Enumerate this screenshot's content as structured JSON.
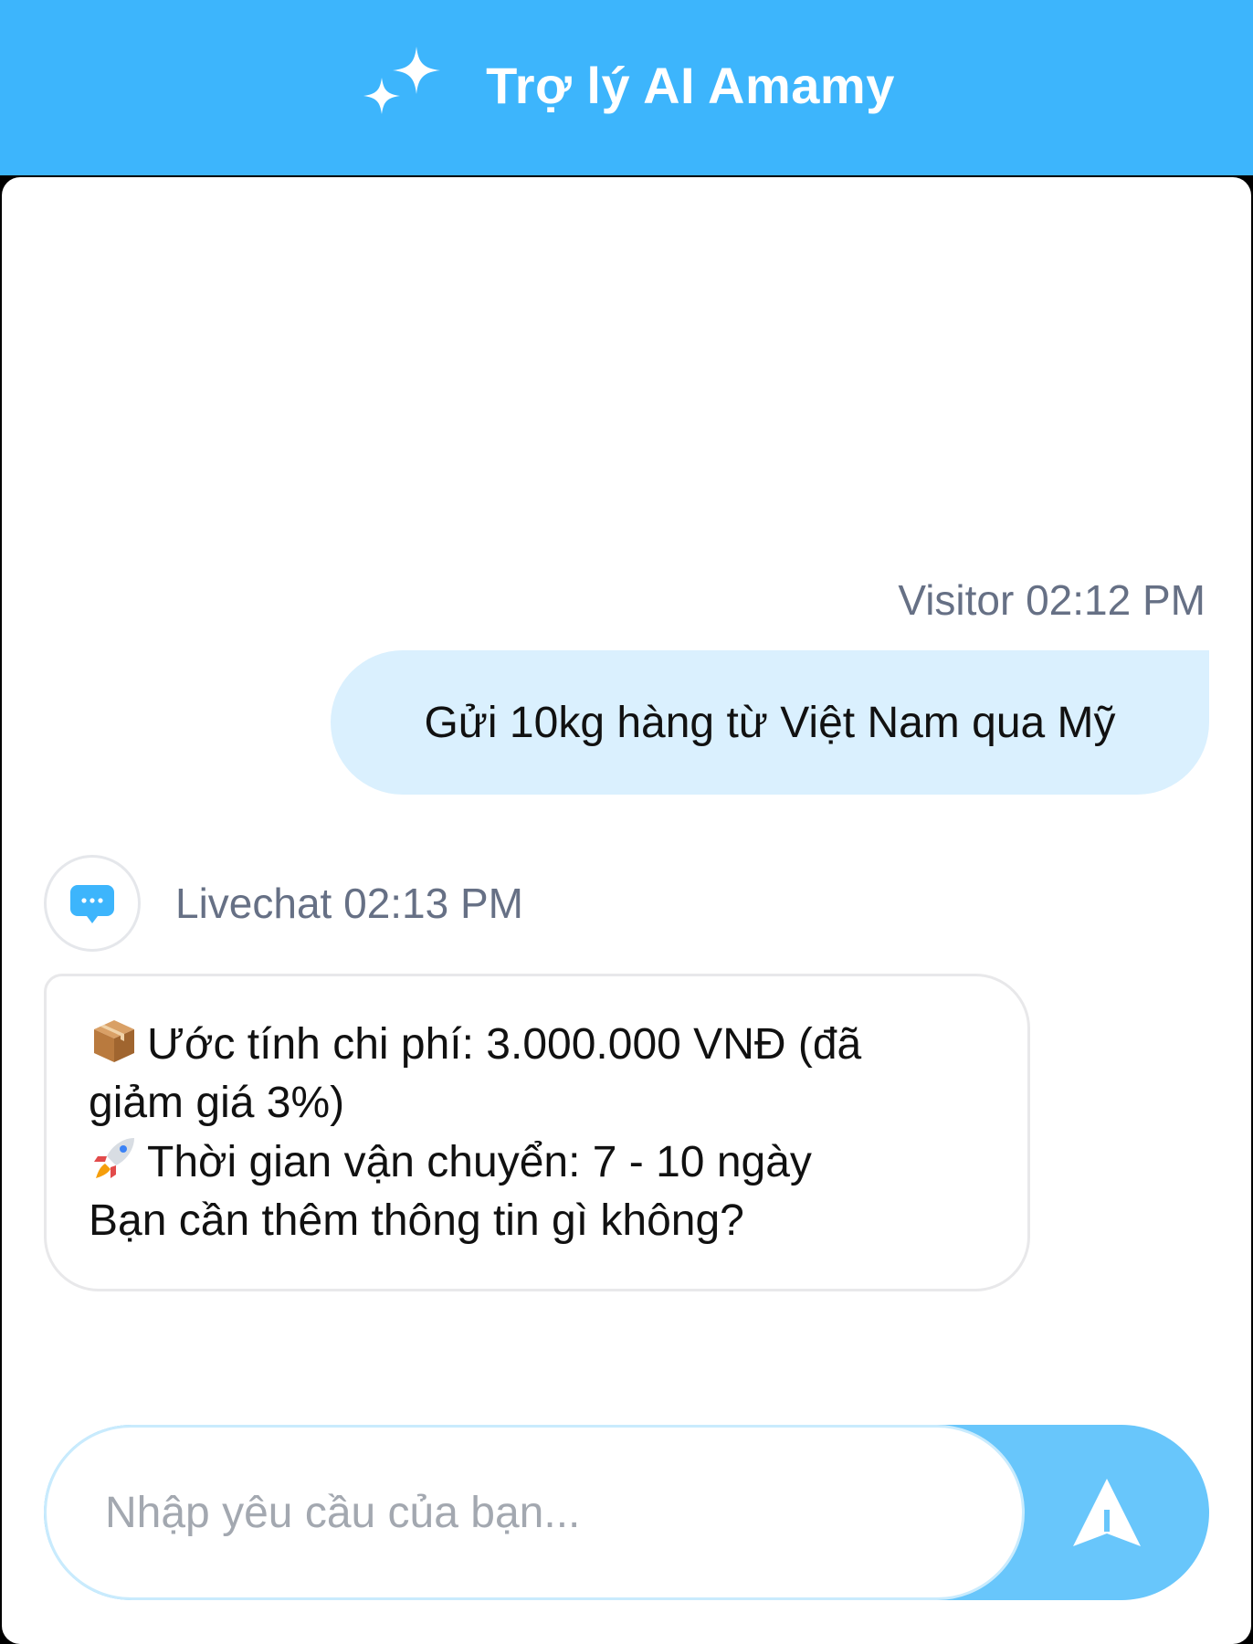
{
  "header": {
    "title": "Trợ lý AI Amamy",
    "icon": "sparkle-icon",
    "background_color": "#3db5fc"
  },
  "messages": [
    {
      "role": "visitor",
      "meta": "Visitor 02:12 PM",
      "text": "Gửi 10kg hàng từ Việt Nam qua Mỹ",
      "bubble_color": "#daf0fe"
    },
    {
      "role": "bot",
      "meta": "Livechat 02:13 PM",
      "avatar_icon": "chat-bubble-icon",
      "lines": [
        "Ước tính chi phí: 3.000.000 VNĐ (đã",
        "giảm giá 3%)",
        "Thời gian vận chuyển: 7 - 10 ngày",
        "Bạn cần thêm thông tin gì không?"
      ],
      "line_icons": [
        "package-icon",
        "",
        "rocket-icon",
        ""
      ]
    }
  ],
  "composer": {
    "placeholder": "Nhập yêu cầu của bạn...",
    "send_icon": "send-icon",
    "accent_color": "#68c6fb"
  }
}
